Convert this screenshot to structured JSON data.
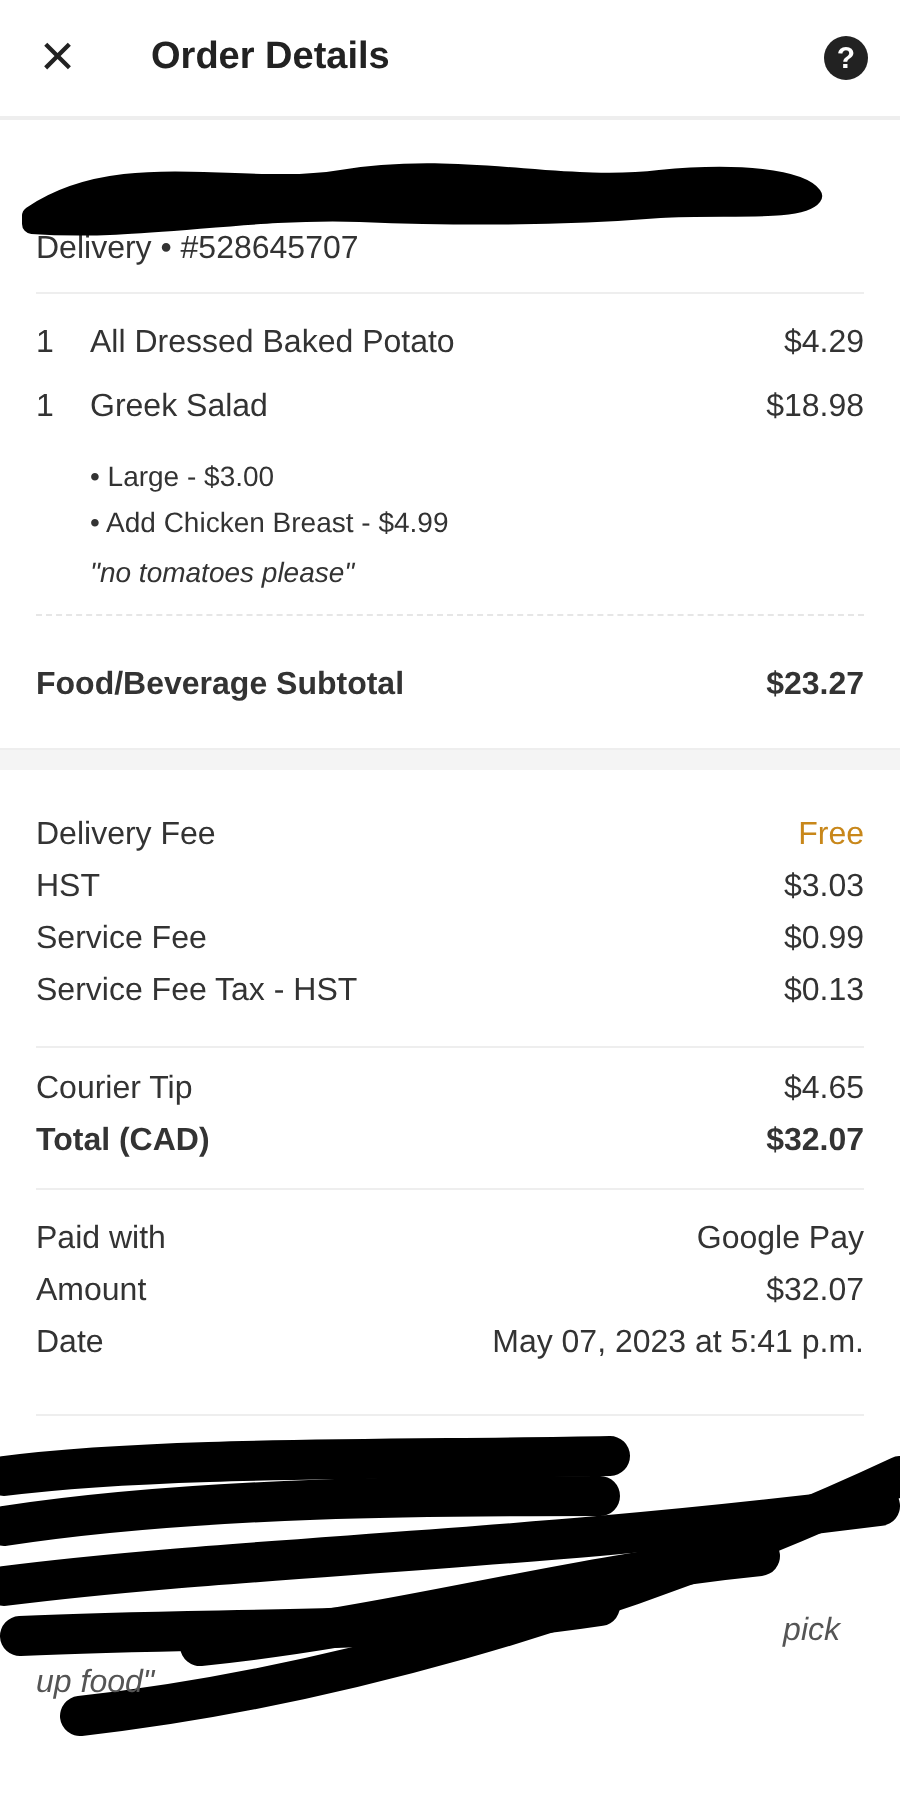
{
  "header": {
    "title": "Order Details",
    "close_icon": "×",
    "help_icon": "?"
  },
  "order": {
    "text": "Delivery • #528645707"
  },
  "items": [
    {
      "qty": "1",
      "name": "All Dressed Baked Potato",
      "price": "$4.29"
    },
    {
      "qty": "1",
      "name": "Greek Salad",
      "price": "$18.98",
      "options": [
        "• Large - $3.00",
        "• Add Chicken Breast - $4.99"
      ],
      "note": "\"no tomatoes please\""
    }
  ],
  "subtotal": {
    "label": "Food/Beverage Subtotal",
    "value": "$23.27"
  },
  "fees": [
    {
      "label": "Delivery Fee",
      "value": "Free",
      "highlight": true
    },
    {
      "label": "HST",
      "value": "$3.03",
      "highlight": false
    },
    {
      "label": "Service Fee",
      "value": "$0.99",
      "highlight": false
    },
    {
      "label": "Service Fee Tax - HST",
      "value": "$0.13",
      "highlight": false
    }
  ],
  "tip": {
    "label": "Courier Tip",
    "value": "$4.65"
  },
  "total": {
    "label": "Total (CAD)",
    "value": "$32.07"
  },
  "payment": [
    {
      "label": "Paid with",
      "value": "Google Pay"
    },
    {
      "label": "Amount",
      "value": "$32.07"
    },
    {
      "label": "Date",
      "value": "May 07, 2023 at 5:41 p.m."
    }
  ],
  "instructions": {
    "line_2_visible": "pick",
    "line_3_visible": "up food\""
  }
}
